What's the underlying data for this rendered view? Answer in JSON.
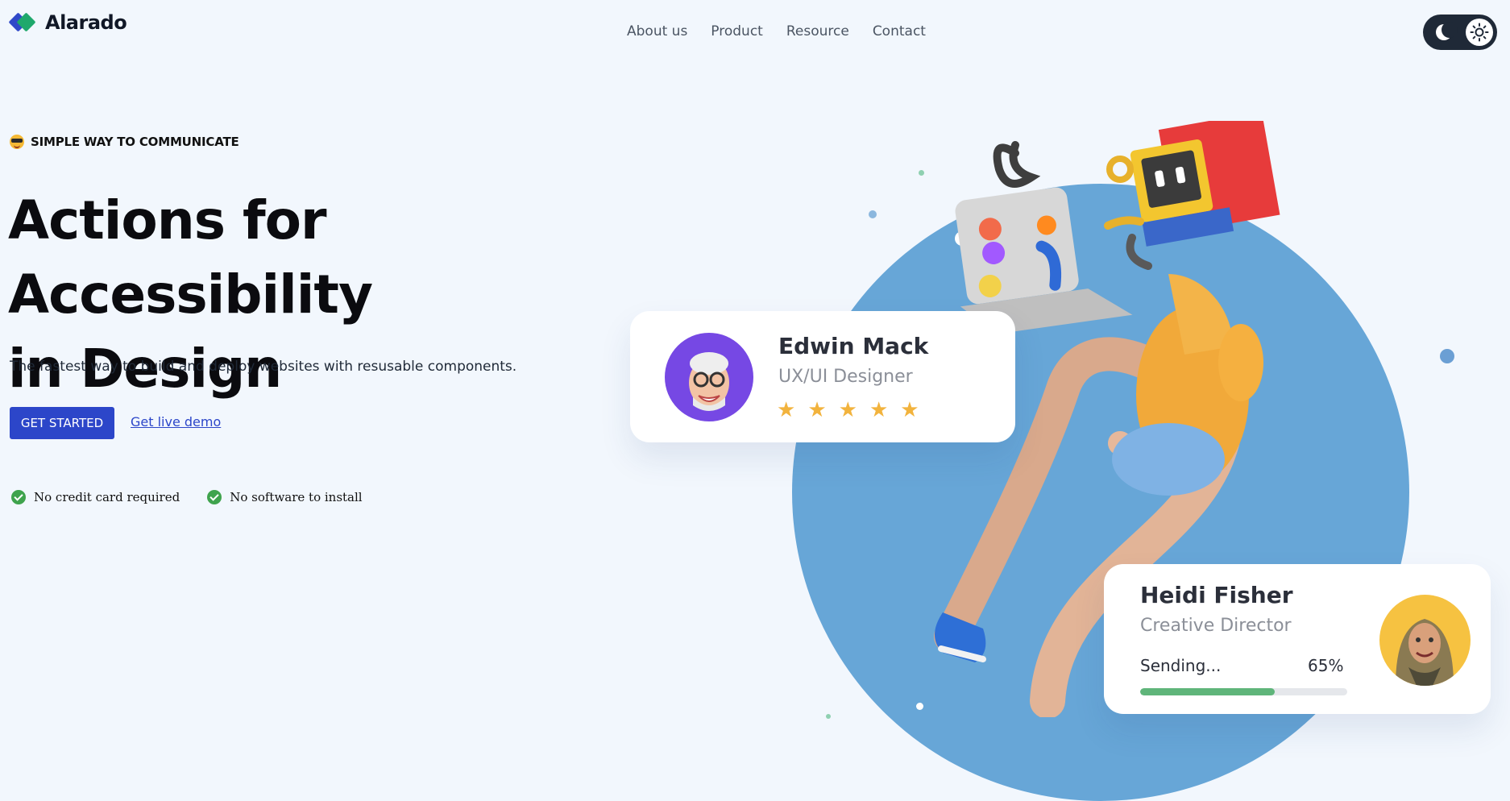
{
  "brand": {
    "name": "Alarado",
    "logo_icon": "diamond-logo-icon"
  },
  "nav": {
    "items": [
      {
        "label": "About us"
      },
      {
        "label": "Product"
      },
      {
        "label": "Resource"
      },
      {
        "label": "Contact"
      }
    ]
  },
  "theme_toggle": {
    "mode": "light",
    "left_icon": "moon-icon",
    "right_icon": "sun-icon"
  },
  "hero": {
    "eyebrow": "SIMPLE WAY TO COMMUNICATE",
    "eyebrow_icon": "sunglasses-emoji-icon",
    "headline_line1": "Actions for Accessibility",
    "headline_line2": "in Design",
    "subtext": "The fastest way to build and deploy websites with resusable components.",
    "primary_button": "GET STARTED",
    "secondary_link": "Get live demo",
    "bullets": [
      {
        "label": "No credit card required",
        "icon": "check-circle-icon"
      },
      {
        "label": "No software to install",
        "icon": "check-circle-icon"
      }
    ]
  },
  "cards": {
    "edwin": {
      "name": "Edwin Mack",
      "role": "UX/UI Designer",
      "rating": 5,
      "star_glyph": "★"
    },
    "heidi": {
      "name": "Heidi Fisher",
      "role": "Creative Director",
      "status_label": "Sending...",
      "progress_text": "65%",
      "progress": 0.65
    }
  },
  "colors": {
    "accent": "#2c46c9",
    "circle": "#67a6d7",
    "star": "#f2b33d",
    "progress": "#5fb57a",
    "check": "#3fa34d"
  }
}
